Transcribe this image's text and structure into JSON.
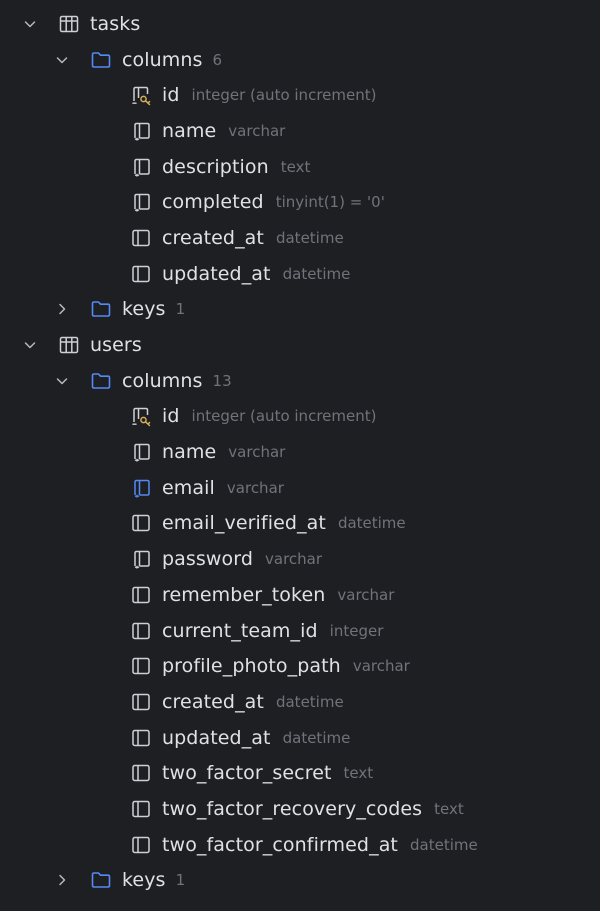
{
  "colors": {
    "background": "#1e1f22",
    "text": "#dfe1e5",
    "muted": "#6f737a",
    "folder": "#548af7",
    "key": "#d6ae58",
    "index_blue": "#548af7"
  },
  "tables": [
    {
      "name": "tasks",
      "columns_label": "columns",
      "columns_count": "6",
      "keys_label": "keys",
      "keys_count": "1",
      "columns": [
        {
          "name": "id",
          "type": "integer (auto increment)",
          "icon": "primary-key-column-icon"
        },
        {
          "name": "name",
          "type": "varchar",
          "icon": "not-null-column-icon"
        },
        {
          "name": "description",
          "type": "text",
          "icon": "not-null-column-icon"
        },
        {
          "name": "completed",
          "type": "tinyint(1) = '0'",
          "icon": "not-null-column-icon"
        },
        {
          "name": "created_at",
          "type": "datetime",
          "icon": "column-icon"
        },
        {
          "name": "updated_at",
          "type": "datetime",
          "icon": "column-icon"
        }
      ]
    },
    {
      "name": "users",
      "columns_label": "columns",
      "columns_count": "13",
      "keys_label": "keys",
      "keys_count": "1",
      "columns": [
        {
          "name": "id",
          "type": "integer (auto increment)",
          "icon": "primary-key-column-icon"
        },
        {
          "name": "name",
          "type": "varchar",
          "icon": "not-null-column-icon"
        },
        {
          "name": "email",
          "type": "varchar",
          "icon": "unique-index-column-icon"
        },
        {
          "name": "email_verified_at",
          "type": "datetime",
          "icon": "column-icon"
        },
        {
          "name": "password",
          "type": "varchar",
          "icon": "not-null-column-icon"
        },
        {
          "name": "remember_token",
          "type": "varchar",
          "icon": "column-icon"
        },
        {
          "name": "current_team_id",
          "type": "integer",
          "icon": "column-icon"
        },
        {
          "name": "profile_photo_path",
          "type": "varchar",
          "icon": "column-icon"
        },
        {
          "name": "created_at",
          "type": "datetime",
          "icon": "column-icon"
        },
        {
          "name": "updated_at",
          "type": "datetime",
          "icon": "column-icon"
        },
        {
          "name": "two_factor_secret",
          "type": "text",
          "icon": "column-icon"
        },
        {
          "name": "two_factor_recovery_codes",
          "type": "text",
          "icon": "column-icon"
        },
        {
          "name": "two_factor_confirmed_at",
          "type": "datetime",
          "icon": "column-icon"
        }
      ]
    }
  ]
}
